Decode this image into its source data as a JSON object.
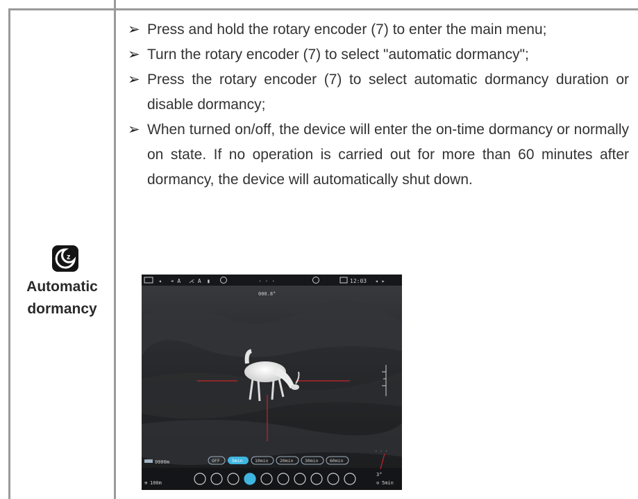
{
  "row": {
    "label": "Automatic\ndormancy",
    "icon": "moon-dormancy-icon"
  },
  "instructions": [
    "Press and hold the rotary encoder (7) to enter the main menu;",
    "Turn the rotary encoder (7) to select \"automatic dormancy\";",
    "Press the rotary encoder (7) to select automatic dormancy duration or disable dormancy;",
    "When turned on/off, the device will enter the on-time dormancy or normally on state. If no operation is carried out for more than 60 minutes after dormancy, the device will automatically shut down."
  ],
  "screenshot": {
    "time": "12:03",
    "heading": "000.8°",
    "distance": "0000m",
    "zoom": "100m",
    "timer": "5min",
    "angle": "3°",
    "dormancy_options": [
      "OFF",
      "5min",
      "10min",
      "20min",
      "30min",
      "60min"
    ],
    "selected_option": "5min",
    "accent_color": "#3fb6e0",
    "reticle_color": "#c8252a"
  }
}
